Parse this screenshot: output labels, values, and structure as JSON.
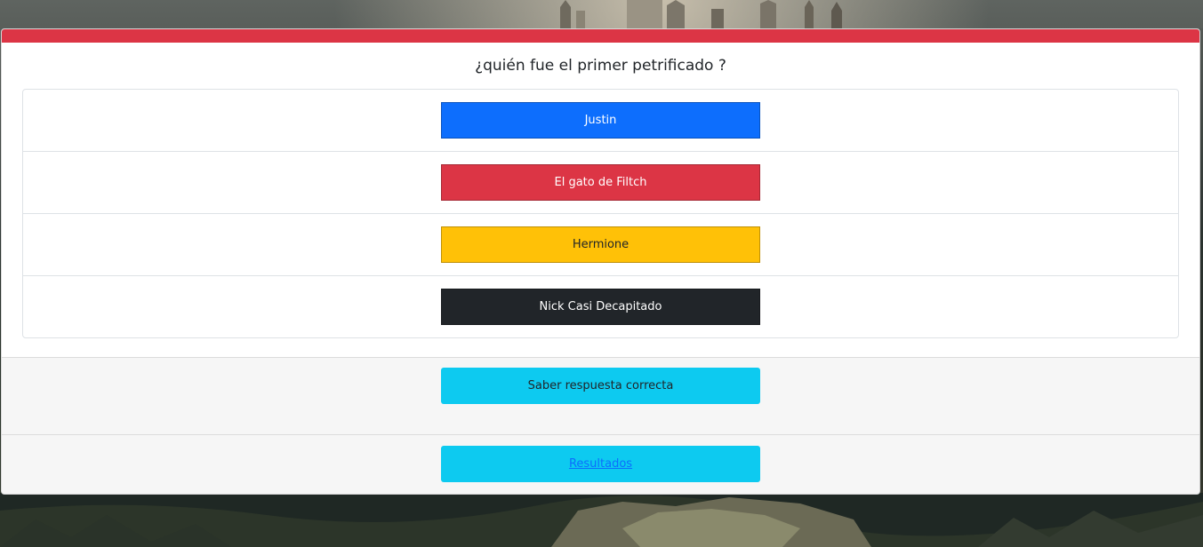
{
  "quiz": {
    "question": "¿quién fue el primer petrificado ?",
    "answers": [
      {
        "label": "Justin"
      },
      {
        "label": "El gato de Filtch"
      },
      {
        "label": "Hermione"
      },
      {
        "label": "Nick Casi Decapitado"
      }
    ],
    "reveal_label": "Saber respuesta correcta",
    "results_label": "Resultados"
  },
  "colors": {
    "header_bar": "#dc3545",
    "answer_1": "#0d6efd",
    "answer_2": "#dc3545",
    "answer_3": "#ffc107",
    "answer_4": "#212529",
    "action_buttons": "#0dcaf0"
  }
}
